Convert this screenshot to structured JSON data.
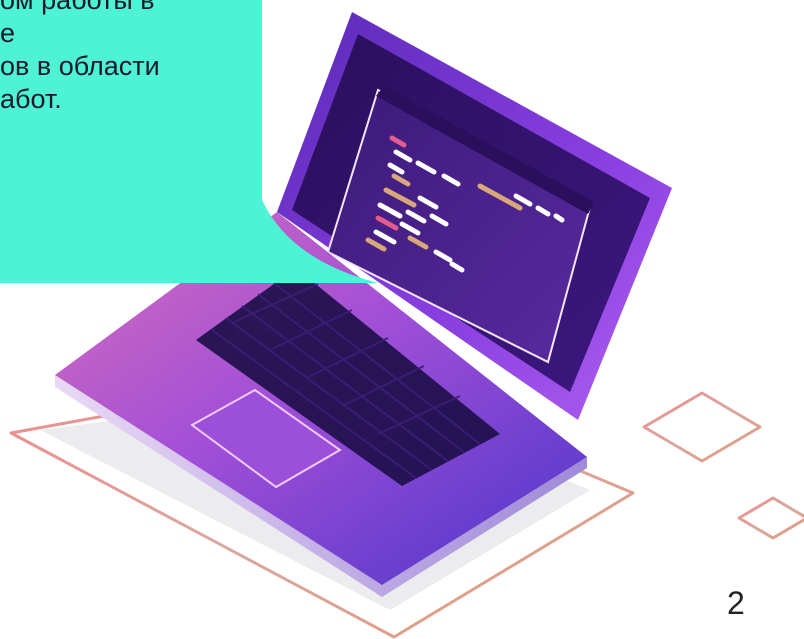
{
  "callout": {
    "lines": [
      "ом работы в",
      "е",
      "ов в области",
      "абот."
    ],
    "background_color": "#4ef2d4"
  },
  "illustration": {
    "name": "laptop-with-code-illustration",
    "accent_colors": [
      "#7b2ff7",
      "#c13aa6",
      "#4a1a8a",
      "#e8b0a0"
    ]
  },
  "slide": {
    "page_number": "2"
  }
}
